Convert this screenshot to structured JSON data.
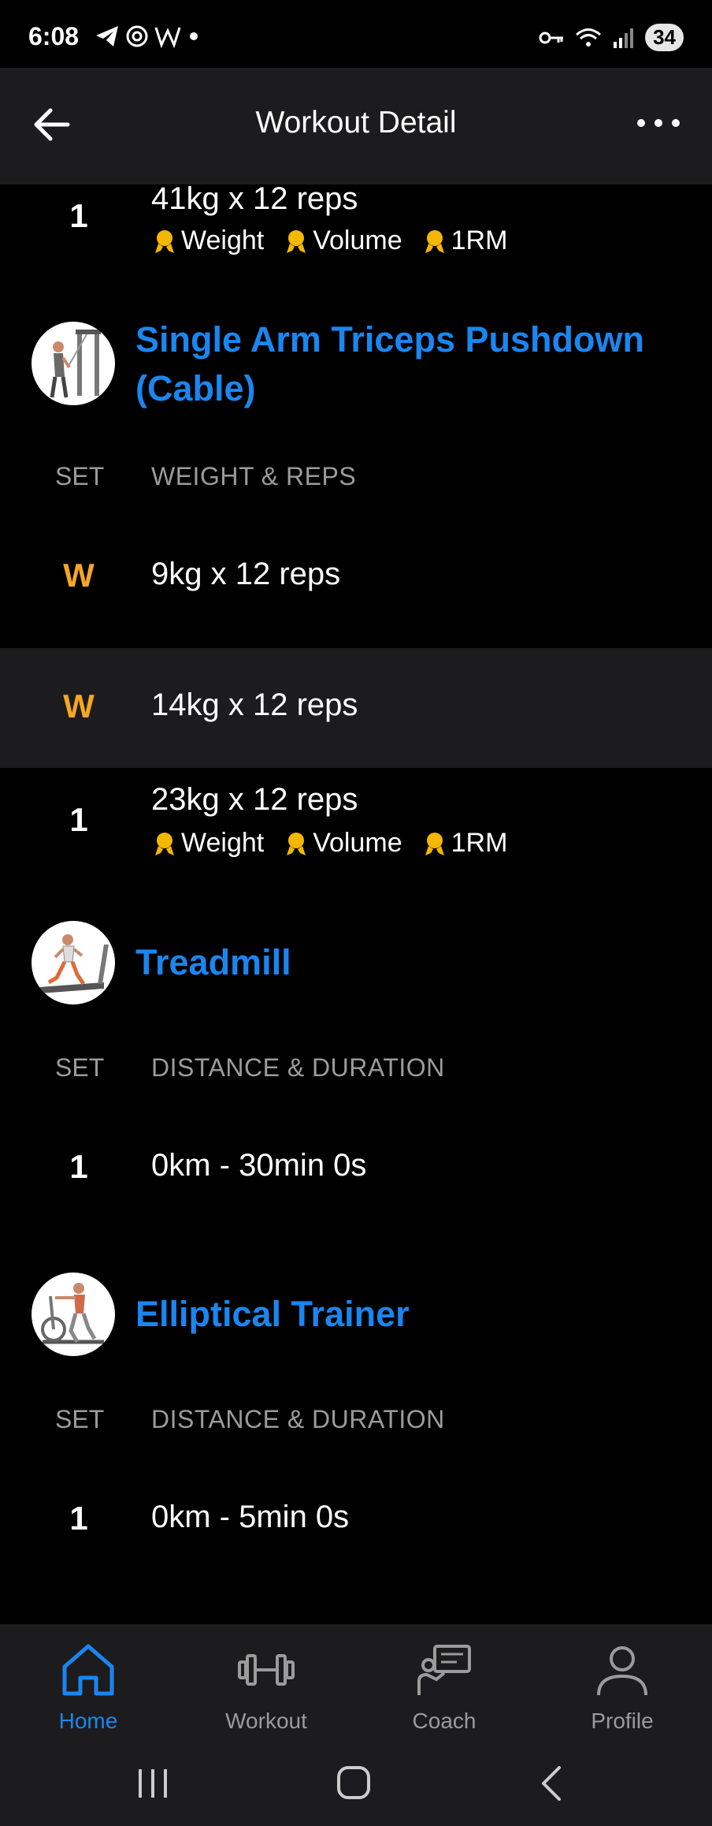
{
  "status_bar": {
    "time": "6:08",
    "battery": "34"
  },
  "header": {
    "title": "Workout Detail"
  },
  "top_set": {
    "set": "1",
    "value": "41kg x 12 reps",
    "badges": [
      "Weight",
      "Volume",
      "1RM"
    ]
  },
  "exercises": [
    {
      "name": "Single Arm Triceps Pushdown (Cable)",
      "col_set": "SET",
      "col_value": "WEIGHT & REPS",
      "sets": [
        {
          "set": "W",
          "value": "9kg x 12 reps"
        },
        {
          "set": "W",
          "value": "14kg x 12 reps"
        },
        {
          "set": "1",
          "value": "23kg x 12 reps",
          "badges": [
            "Weight",
            "Volume",
            "1RM"
          ]
        }
      ]
    },
    {
      "name": "Treadmill",
      "col_set": "SET",
      "col_value": "DISTANCE & DURATION",
      "sets": [
        {
          "set": "1",
          "value": "0km - 30min 0s"
        }
      ]
    },
    {
      "name": "Elliptical Trainer",
      "col_set": "SET",
      "col_value": "DISTANCE & DURATION",
      "sets": [
        {
          "set": "1",
          "value": "0km - 5min 0s"
        }
      ]
    }
  ],
  "bottom_nav": [
    {
      "label": "Home",
      "icon": "home-icon",
      "active": true
    },
    {
      "label": "Workout",
      "icon": "dumbbell-icon",
      "active": false
    },
    {
      "label": "Coach",
      "icon": "coach-icon",
      "active": false
    },
    {
      "label": "Profile",
      "icon": "profile-icon",
      "active": false
    }
  ],
  "colors": {
    "accent": "#1a86f0",
    "warmup": "#f5a623",
    "medal": "#f5b800"
  }
}
